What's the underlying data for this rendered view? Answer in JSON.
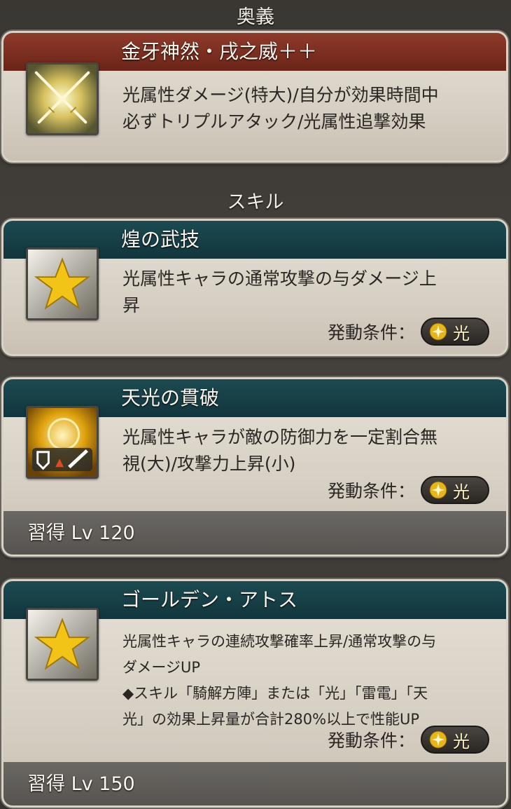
{
  "ougi": {
    "section_title": "奥義",
    "name": "金牙神然・戌之威＋＋",
    "description_line1": "光属性ダメージ(特大)/自分が効果時間中",
    "description_line2": "必ずトリプルアタック/光属性追撃効果",
    "icon": "crossed-swords-icon"
  },
  "skills_section_title": "スキル",
  "skills": [
    {
      "name": "煌の武技",
      "description_line1": "光属性キャラの通常攻撃の与ダメージ上",
      "description_line2": "昇",
      "condition_label": "発動条件：",
      "condition_element": "光",
      "icon": "star-icon"
    },
    {
      "name": "天光の貫破",
      "description_line1": "光属性キャラが敵の防御力を一定割合無",
      "description_line2": "視(大)/攻撃力上昇(小)",
      "condition_label": "発動条件：",
      "condition_element": "光",
      "learn_level": "習得 Lv 120",
      "icon": "light-shield-sword-icon"
    },
    {
      "name": "ゴールデン・アトス",
      "description_line1": "光属性キャラの連続攻撃確率上昇/通常攻撃の与",
      "description_line2": "ダメージUP",
      "description_line3": "◆スキル「騎解方陣」または「光」「雷電」「天",
      "description_line4": "光」の効果上昇量が合計280%以上で性能UP",
      "condition_label": "発動条件：",
      "condition_element": "光",
      "learn_level": "習得 Lv 150",
      "icon": "star-icon"
    }
  ],
  "colors": {
    "ougi_title_bar": "#7a2e20",
    "skill_title_bar": "#17404a",
    "badge_text": "#fff3c0"
  }
}
